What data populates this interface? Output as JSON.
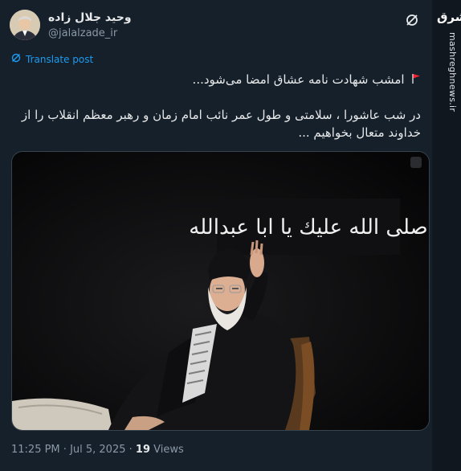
{
  "author": {
    "name": "وحید جلال زاده",
    "handle": "@jalalzade_ir"
  },
  "translate_label": "Translate post",
  "tweet": {
    "line1": "امشب شهادت نامه عشاق امضا می‌شود...",
    "line2": "در شب عاشورا ، سلامتی و طول عمر نائب امام زمان و رهبر معظم انقلاب را از",
    "line3": "خداوند متعال بخواهیم ..."
  },
  "media": {
    "banner_text": "صلى الله عليك يا ابا عبدالله"
  },
  "footer": {
    "time": "11:25 PM",
    "separator1": " · ",
    "date": "Jul 5, 2025",
    "separator2": " · ",
    "views_count": "19",
    "views_label": " Views"
  },
  "watermark": {
    "logo": "مشرق",
    "site": "mashreghnews.ir"
  },
  "icons": {
    "grok": "grok-icon",
    "translate": "translate-icon",
    "flag": "red-flag-icon"
  },
  "colors": {
    "background": "#15202b",
    "accent": "#1d9bf0",
    "muted": "#8b98a5",
    "text": "#e7e9ea"
  }
}
